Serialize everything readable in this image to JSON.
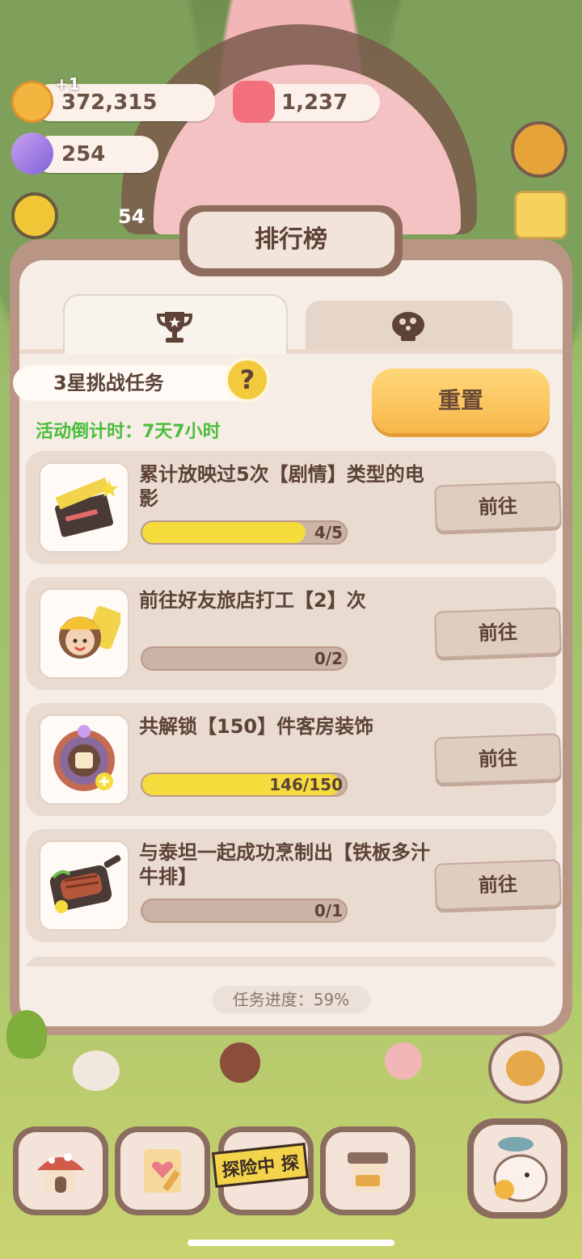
{
  "currencies": {
    "coins": "372,315",
    "coins_bonus": "+1",
    "gems": "1,237",
    "candy": "254",
    "side_counter": "54"
  },
  "panel": {
    "title": "排行榜",
    "challenge_label": "3星挑战任务",
    "help_symbol": "?",
    "reset_label": "重置",
    "countdown": "活动倒计时：7天7小时",
    "overall_progress": "任务进度：59%"
  },
  "tasks": [
    {
      "text": "累计放映过5次【剧情】类型的电影",
      "progress_text": "4/5",
      "fraction": 0.8,
      "go_label": "前往"
    },
    {
      "text": "前往好友旅店打工【2】次",
      "progress_text": "0/2",
      "fraction": 0.0,
      "go_label": "前往"
    },
    {
      "text": "共解锁【150】件客房装饰",
      "progress_text": "146/150",
      "fraction": 0.973,
      "go_label": "前往"
    },
    {
      "text": "与泰坦一起成功烹制出【铁板多汁牛排】",
      "progress_text": "0/1",
      "fraction": 0.0,
      "go_label": "前往"
    }
  ],
  "bottom": {
    "adventure_banner": "探险中 探"
  },
  "colors": {
    "accent_yellow": "#f5dc3c",
    "countdown_green": "#4bbd3c",
    "panel_brown": "#b99585"
  }
}
